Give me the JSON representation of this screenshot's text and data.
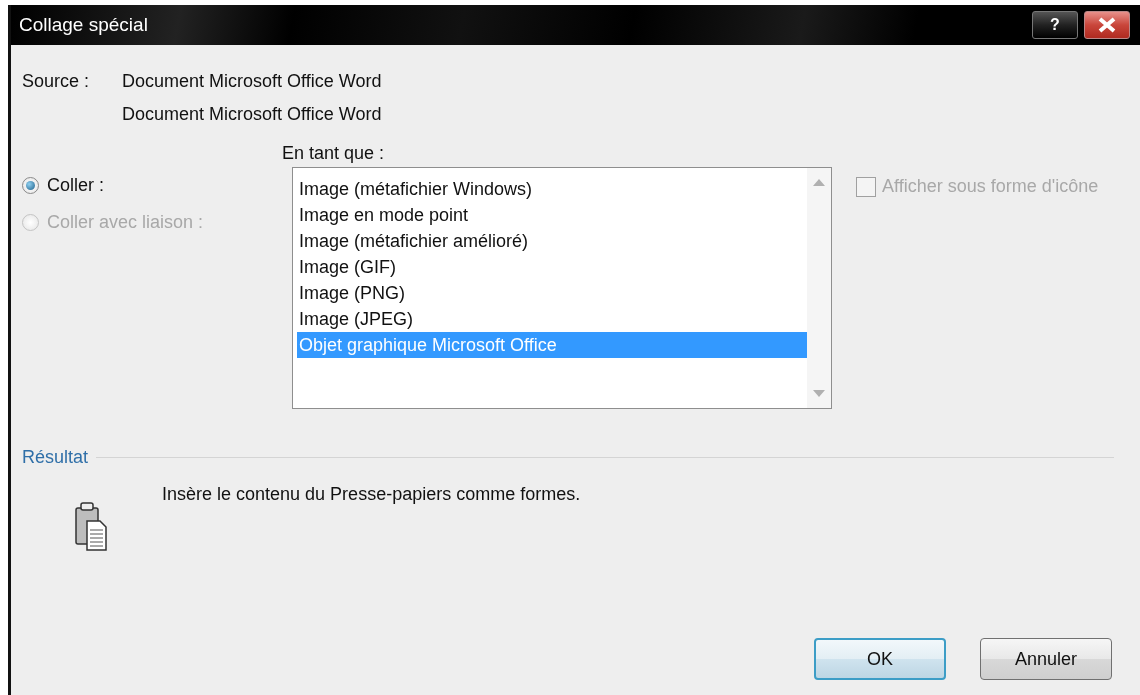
{
  "window": {
    "title": "Collage spécial",
    "help_button": "?"
  },
  "source": {
    "label": "Source :",
    "lines": [
      "Document Microsoft Office Word",
      "Document Microsoft Office Word"
    ]
  },
  "as_label": "En tant que :",
  "paste_options": [
    {
      "label": "Coller :",
      "selected": true,
      "disabled": false
    },
    {
      "label": "Coller avec liaison :",
      "selected": false,
      "disabled": true
    }
  ],
  "formats": [
    {
      "label": "Image (métafichier Windows)",
      "selected": false
    },
    {
      "label": "Image en mode point",
      "selected": false
    },
    {
      "label": "Image (métafichier amélioré)",
      "selected": false
    },
    {
      "label": "Image (GIF)",
      "selected": false
    },
    {
      "label": "Image (PNG)",
      "selected": false
    },
    {
      "label": "Image (JPEG)",
      "selected": false
    },
    {
      "label": "Objet graphique Microsoft Office",
      "selected": true
    }
  ],
  "display_as_icon": {
    "label": "Afficher sous forme d'icône",
    "checked": false,
    "disabled": true
  },
  "result": {
    "heading": "Résultat",
    "description": "Insère le contenu du Presse-papiers comme formes."
  },
  "buttons": [
    {
      "label": "OK",
      "default": true
    },
    {
      "label": "Annuler",
      "default": false
    }
  ]
}
